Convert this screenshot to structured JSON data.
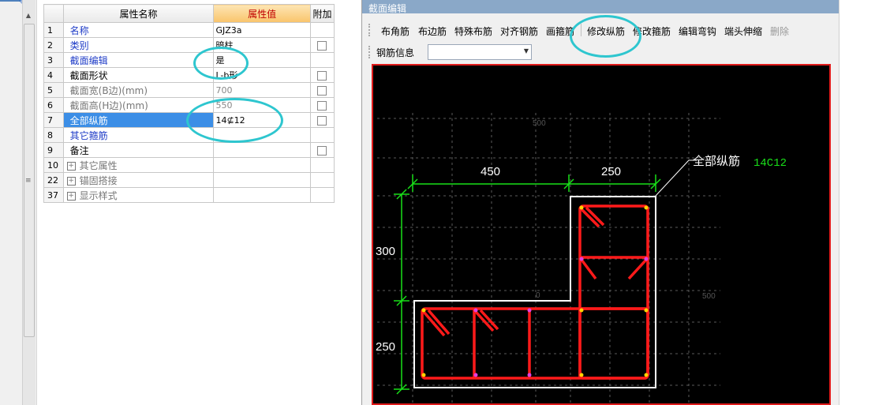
{
  "grid": {
    "headers": {
      "name": "属性名称",
      "value": "属性值",
      "extra": "附加"
    },
    "rows": [
      {
        "idx": "1",
        "name": "名称",
        "value": "GJZ3a",
        "nameColor": "blue",
        "checkbox": false
      },
      {
        "idx": "2",
        "name": "类别",
        "value": "暗柱",
        "nameColor": "blue",
        "checkbox": true
      },
      {
        "idx": "3",
        "name": "截面编辑",
        "value": "是",
        "nameColor": "blue",
        "checkbox": false
      },
      {
        "idx": "4",
        "name": "截面形状",
        "value": "L-b形",
        "nameColor": "black",
        "checkbox": true
      },
      {
        "idx": "5",
        "name": "截面宽(B边)(mm)",
        "value": "700",
        "nameColor": "grey",
        "checkbox": true
      },
      {
        "idx": "6",
        "name": "截面高(H边)(mm)",
        "value": "550",
        "nameColor": "grey",
        "checkbox": true
      },
      {
        "idx": "7",
        "name": "全部纵筋",
        "value": "14⊈12",
        "nameColor": "selected",
        "checkbox": true
      },
      {
        "idx": "8",
        "name": "其它箍筋",
        "value": "",
        "nameColor": "blue",
        "checkbox": false
      },
      {
        "idx": "9",
        "name": "备注",
        "value": "",
        "nameColor": "black",
        "checkbox": true
      },
      {
        "idx": "10",
        "name": "其它属性",
        "value": "",
        "nameColor": "grey",
        "checkbox": false,
        "expand": true
      },
      {
        "idx": "22",
        "name": "锚固搭接",
        "value": "",
        "nameColor": "grey",
        "checkbox": false,
        "expand": true
      },
      {
        "idx": "37",
        "name": "显示样式",
        "value": "",
        "nameColor": "grey",
        "checkbox": false,
        "expand": true
      }
    ]
  },
  "dialog": {
    "title": "截面编辑",
    "toolbar": [
      "布角筋",
      "布边筋",
      "特殊布筋",
      "对齐钢筋",
      "画箍筋",
      "修改纵筋",
      "修改箍筋",
      "编辑弯钩",
      "端头伸缩",
      "删除"
    ],
    "rebar_info_label": "钢筋信息",
    "rebar_info_value": ""
  },
  "drawing": {
    "dim_top_left": "450",
    "dim_top_right": "250",
    "dim_left_upper": "300",
    "dim_left_lower": "250",
    "annotation_label": "全部纵筋",
    "annotation_value": "14C12",
    "grid_label_top": "500",
    "grid_label_right": "500",
    "grid_label_zero": "0"
  },
  "colors": {
    "highlight_circle": "#2ec6cf",
    "dimension": "#19e019",
    "rebar": "#ff1a1a",
    "outline": "#ffffff",
    "selected_row": "#3c8ee6"
  }
}
